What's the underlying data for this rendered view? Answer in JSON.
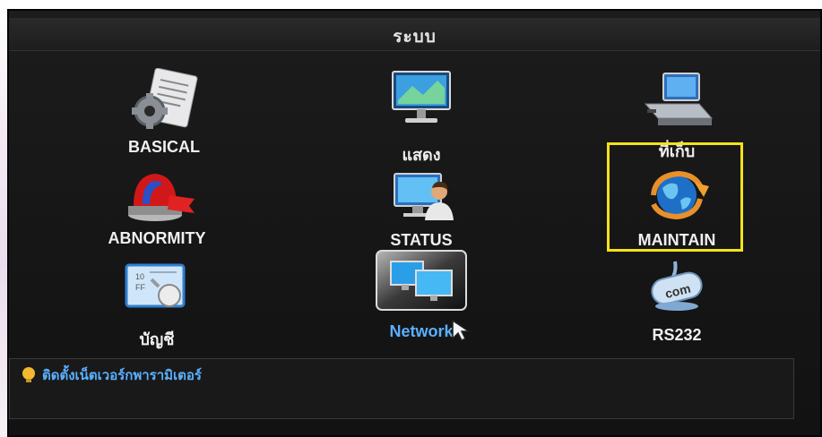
{
  "title": "ระบบ",
  "menu": [
    {
      "label": "BASICAL",
      "icon": "settings-document-icon",
      "selected": false
    },
    {
      "label": "แสดง",
      "icon": "monitor-icon",
      "selected": false
    },
    {
      "label": "ที่เก็บ",
      "icon": "storage-drive-icon",
      "selected": false
    },
    {
      "label": "ABNORMITY",
      "icon": "alarm-siren-icon",
      "selected": false
    },
    {
      "label": "STATUS",
      "icon": "user-status-icon",
      "selected": false
    },
    {
      "label": "MAINTAIN",
      "icon": "maintenance-globe-icon",
      "selected": false,
      "highlighted": true
    },
    {
      "label": "บัญชี",
      "icon": "account-icon",
      "selected": false
    },
    {
      "label": "Network",
      "icon": "network-icon",
      "selected": true
    },
    {
      "label": "RS232",
      "icon": "serial-com-icon",
      "selected": false
    }
  ],
  "hint": {
    "text": "ติดตั้งเน็ตเวอร์กพารามิเตอร์",
    "icon": "lightbulb-icon"
  },
  "colors": {
    "highlight": "#f4e21a",
    "selected_text": "#5ab0ff",
    "background": "#161616"
  }
}
